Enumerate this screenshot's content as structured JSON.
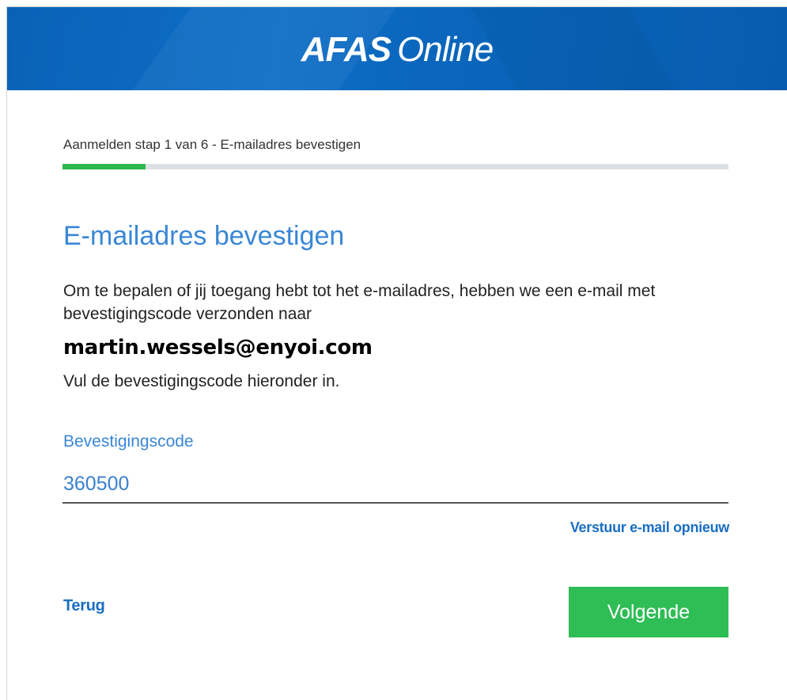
{
  "header": {
    "logo_bold": "AFAS",
    "logo_light": "Online",
    "brand_color": "#0a66bc"
  },
  "progress": {
    "step_label": "Aanmelden stap 1 van 6 - E-mailadres bevestigen",
    "current_step": 1,
    "total_steps": 6,
    "fraction": 0.125,
    "fill_color": "#2db84e"
  },
  "main": {
    "title": "E-mailadres bevestigen",
    "intro": "Om te bepalen of jij toegang hebt tot het e-mailadres, hebben we een e-mail met bevestigingscode verzonden naar",
    "email": "martin.wessels@enyoi.com",
    "instruction": "Vul de bevestigingscode hieronder in.",
    "code_label": "Bevestigingscode",
    "code_value": "360500",
    "resend_link": "Verstuur e-mail opnieuw"
  },
  "footer": {
    "back_link": "Terug",
    "next_button": "Volgende",
    "next_color": "#2fbd55"
  }
}
